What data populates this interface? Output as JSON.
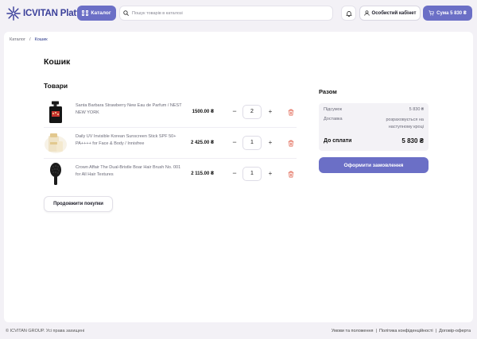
{
  "header": {
    "logo_text": "ICVITAN Platform",
    "catalog_label": "Каталог",
    "search_placeholder": "Пошук товарів в каталозі",
    "account_label": "Особистий кабінет",
    "cart_label": "Сума 5 830 ₴",
    "accent_color": "#6b6fc6"
  },
  "breadcrumb": {
    "items": [
      "Каталог",
      "/",
      "Кошик"
    ]
  },
  "page": {
    "title": "Кошик",
    "section_title": "Товари",
    "continue_label": "Продовжити покупки"
  },
  "products": [
    {
      "name": "Santa Barbara Strawberry New Eau de Parfum / NEST NEW YORK",
      "price": "1500.00 ₴",
      "qty": "2",
      "minus": "−",
      "plus": "+",
      "thumb": "perfume-bottle-icon"
    },
    {
      "name": "Daily UV Invisible Korean Sunscreen Stick SPF 50+ PA++++ for Face & Body / Innisfree",
      "price": "2 425.00 ₴",
      "qty": "1",
      "minus": "−",
      "plus": "+",
      "thumb": "sunscreen-stick-icon"
    },
    {
      "name": "Crown Affair The Dual-Bristle Boar Hair Brush No. 001 for All Hair Textures",
      "price": "2 115.00 ₴",
      "qty": "1",
      "minus": "−",
      "plus": "+",
      "thumb": "hair-brush-icon"
    }
  ],
  "summary": {
    "title": "Разом",
    "subtotal_label": "Підсумок",
    "subtotal_value": "5 830 ₴",
    "delivery_label": "Доставка",
    "delivery_value_line1": "розраховується на",
    "delivery_value_line2": "наступному кроці",
    "total_label": "До сплати",
    "total_value": "5 830 ₴",
    "order_button": "Оформити замовлення"
  },
  "footer": {
    "copyright": "© ICVITAN GROUP. Усі права захищені",
    "links": [
      "Умови та положення",
      "|",
      "Політика конфіденційності",
      "|",
      "Договір-оферта"
    ]
  }
}
